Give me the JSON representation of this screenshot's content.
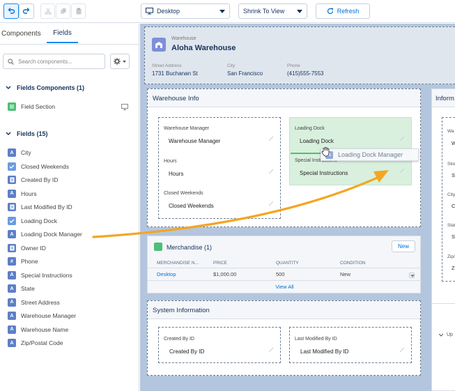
{
  "toolbar": {
    "device": "Desktop",
    "view_mode": "Shrink To View",
    "refresh": "Refresh"
  },
  "left_panel": {
    "tabs": [
      "Components",
      "Fields"
    ],
    "active_tab": "Fields",
    "search_placeholder": "Search components...",
    "field_components_header": "Fields Components (1)",
    "field_components": [
      {
        "label": "Field Section",
        "icon": "field-section-icon"
      }
    ],
    "fields_header": "Fields (15)",
    "fields": [
      {
        "label": "City",
        "icon": "A"
      },
      {
        "label": "Closed Weekends",
        "icon": "check"
      },
      {
        "label": "Created By ID",
        "icon": "doc"
      },
      {
        "label": "Hours",
        "icon": "A"
      },
      {
        "label": "Last Modified By ID",
        "icon": "doc"
      },
      {
        "label": "Loading Dock",
        "icon": "check"
      },
      {
        "label": "Loading Dock Manager",
        "icon": "A"
      },
      {
        "label": "Owner ID",
        "icon": "doc"
      },
      {
        "label": "Phone",
        "icon": "#"
      },
      {
        "label": "Special Instructions",
        "icon": "A"
      },
      {
        "label": "State",
        "icon": "A"
      },
      {
        "label": "Street Address",
        "icon": "A"
      },
      {
        "label": "Warehouse Manager",
        "icon": "A"
      },
      {
        "label": "Warehouse Name",
        "icon": "A"
      },
      {
        "label": "Zip/Postal Code",
        "icon": "A"
      }
    ]
  },
  "record": {
    "object_label": "Warehouse",
    "name": "Aloha Warehouse",
    "highlights": [
      {
        "label": "Street Address",
        "value": "1731 Buchanan St"
      },
      {
        "label": "City",
        "value": "San Francisco"
      },
      {
        "label": "Phone",
        "value": "(415)555-7553"
      }
    ]
  },
  "warehouse_info": {
    "title": "Warehouse Info",
    "left_fields": [
      {
        "label": "Warehouse Manager",
        "value": "Warehouse Manager"
      },
      {
        "label": "Hours",
        "value": "Hours"
      },
      {
        "label": "Closed Weekends",
        "value": "Closed Weekends"
      }
    ],
    "right_fields": [
      {
        "label": "Loading Dock",
        "value": "Loading Dock"
      },
      {
        "label": "Special Instructions",
        "value": "Special Instructions"
      }
    ]
  },
  "drag_label": "Loading Dock Manager",
  "merchandise": {
    "title": "Merchandise (1)",
    "new_button": "New",
    "columns": [
      "MERCHANDISE N...",
      "PRICE",
      "QUANTITY",
      "CONDITION"
    ],
    "row": [
      "Desktop",
      "$1,000.00",
      "500",
      "New"
    ],
    "view_all": "View All"
  },
  "system_info": {
    "title": "System Information",
    "fields": [
      {
        "label": "Created By ID",
        "value": "Created By ID"
      },
      {
        "label": "Last Modified By ID",
        "value": "Last Modified By ID"
      }
    ]
  },
  "right_card": {
    "title": "Inform",
    "fragments": [
      "Wa",
      "W",
      "Stre",
      "St",
      "City",
      "C",
      "Stat",
      "St",
      "Zip/",
      "Zi"
    ],
    "footer": "Up"
  },
  "colors": {
    "accent": "#0070d2",
    "canvas": "#b3c6de",
    "drop_zone": "#d9f0de",
    "drag_arrow": "#f4a623",
    "field_icon": "#5d7fc7",
    "check_icon": "#6b9be0"
  }
}
